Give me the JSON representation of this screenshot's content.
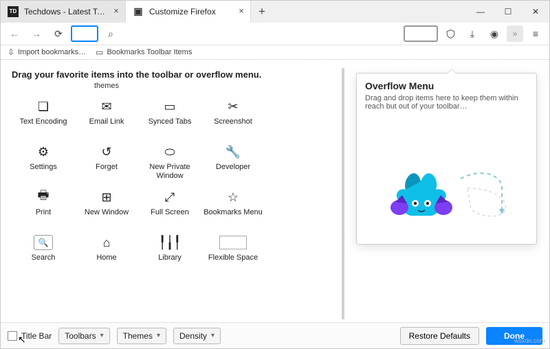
{
  "tabs": [
    {
      "title": "Techdows - Latest Technology N",
      "close": "×"
    },
    {
      "title": "Customize Firefox",
      "close": "×"
    }
  ],
  "newtab_glyph": "+",
  "window_controls": {
    "minimize": "—",
    "maximize": "☐",
    "close": "✕"
  },
  "nav": {
    "back": "←",
    "forward": "→",
    "reload": "⟳",
    "search_glyph": "⌕",
    "shield": "◇",
    "download": "⤓",
    "account": "◉",
    "overflow": "»",
    "menu": "≡"
  },
  "bookmarks_bar": {
    "import": "Import bookmarks…",
    "import_icon": "⇩",
    "toolbar_items": "Bookmarks Toolbar Items",
    "folder_icon": "▭"
  },
  "heading": "Drag your favorite items into the toolbar or overflow menu.",
  "stub_row": {
    "themes": "themes"
  },
  "palette": [
    {
      "id": "text-encoding",
      "label": "Text Encoding",
      "glyph": "❏"
    },
    {
      "id": "email-link",
      "label": "Email Link",
      "glyph": "✉"
    },
    {
      "id": "synced-tabs",
      "label": "Synced Tabs",
      "glyph": "▭"
    },
    {
      "id": "screenshot",
      "label": "Screenshot",
      "glyph": "✂"
    },
    {
      "id": "settings",
      "label": "Settings",
      "glyph": "⚙"
    },
    {
      "id": "forget",
      "label": "Forget",
      "glyph": "↺"
    },
    {
      "id": "new-private-window",
      "label": "New Private Window",
      "glyph": "⬭"
    },
    {
      "id": "developer",
      "label": "Developer",
      "glyph": "🔧"
    },
    {
      "id": "print",
      "label": "Print",
      "glyph": "🖶"
    },
    {
      "id": "new-window",
      "label": "New Window",
      "glyph": "⊞"
    },
    {
      "id": "full-screen",
      "label": "Full Screen",
      "glyph": "⤢"
    },
    {
      "id": "bookmarks-menu",
      "label": "Bookmarks Menu",
      "glyph": "☆"
    },
    {
      "id": "search",
      "label": "Search",
      "glyph": "🔍",
      "framed": true
    },
    {
      "id": "home",
      "label": "Home",
      "glyph": "⌂"
    },
    {
      "id": "library",
      "label": "Library",
      "glyph": "╿╽╿"
    },
    {
      "id": "flexible-space",
      "label": "Flexible Space",
      "glyph": "",
      "flex": true
    }
  ],
  "overflow": {
    "title": "Overflow Menu",
    "desc": "Drag and drop items here to keep them within reach but out of your toolbar…"
  },
  "footer": {
    "title_bar": "Title Bar",
    "toolbars": "Toolbars",
    "themes": "Themes",
    "density": "Density",
    "restore": "Restore Defaults",
    "done": "Done"
  },
  "watermark": "wsxdn.com"
}
